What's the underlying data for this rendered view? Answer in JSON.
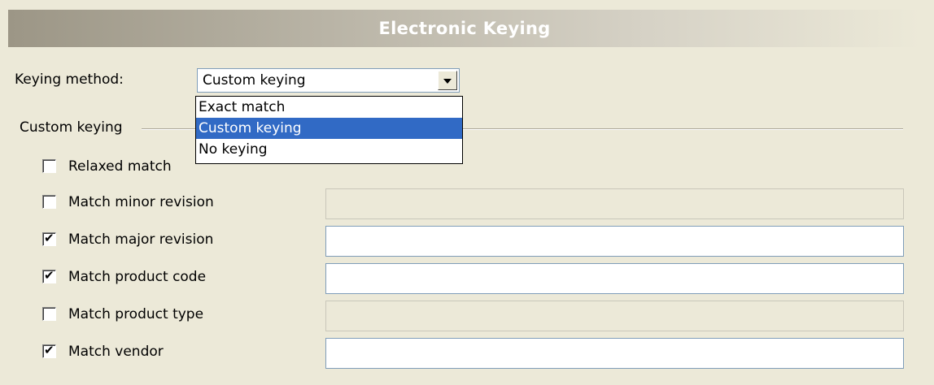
{
  "header": {
    "title": "Electronic Keying"
  },
  "keying": {
    "label": "Keying method:",
    "value": "Custom keying",
    "options": [
      "Exact match",
      "Custom keying",
      "No keying"
    ],
    "selected_index": 1
  },
  "group": {
    "label": "Custom keying"
  },
  "checks": [
    {
      "label": "Relaxed match",
      "checked": false,
      "has_field": false
    },
    {
      "label": "Match minor revision",
      "checked": false,
      "has_field": true,
      "field_enabled": false,
      "value": ""
    },
    {
      "label": "Match major revision",
      "checked": true,
      "has_field": true,
      "field_enabled": true,
      "value": ""
    },
    {
      "label": "Match product code",
      "checked": true,
      "has_field": true,
      "field_enabled": true,
      "value": ""
    },
    {
      "label": "Match product type",
      "checked": false,
      "has_field": true,
      "field_enabled": false,
      "value": ""
    },
    {
      "label": "Match vendor",
      "checked": true,
      "has_field": true,
      "field_enabled": true,
      "value": ""
    }
  ]
}
